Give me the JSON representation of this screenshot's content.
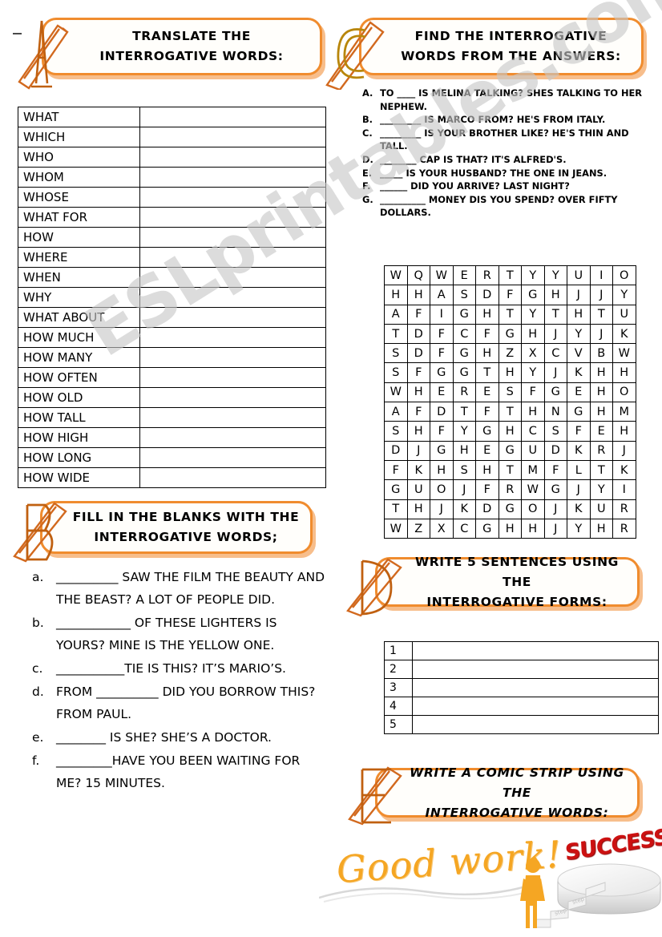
{
  "theme": {
    "accent": "#F08C2E",
    "accent_shadow": "#F7BE8C",
    "watermark_color": "#c8c8c8",
    "goodwork_color": "#F5A623",
    "success_color": "#CC1111"
  },
  "watermark": {
    "text": "ESLprintables.com"
  },
  "sections": {
    "a": {
      "marker": "A",
      "title_line1": "TRANSLATE THE",
      "title_line2": "INTERROGATIVE WORDS:",
      "words": [
        "WHAT",
        "WHICH",
        "WHO",
        "WHOM",
        "WHOSE",
        "WHAT FOR",
        "HOW",
        "WHERE",
        "WHEN",
        "WHY",
        "WHAT ABOUT",
        "HOW MUCH",
        "HOW MANY",
        "HOW OFTEN",
        "HOW OLD",
        "HOW TALL",
        "HOW HIGH",
        "HOW LONG",
        "HOW WIDE"
      ]
    },
    "b": {
      "marker": "B",
      "title_line1": "FILL IN THE BLANKS WITH THE",
      "title_line2": "INTERROGATIVE WORDS;",
      "items": [
        {
          "mark": "a.",
          "text": "__________ SAW THE FILM THE BEAUTY AND THE BEAST? A LOT OF PEOPLE DID."
        },
        {
          "mark": "b.",
          "text": "____________ OF THESE LIGHTERS IS YOURS? MINE IS THE YELLOW ONE."
        },
        {
          "mark": "c.",
          "text": "___________TIE IS THIS? IT’S MARIO’S."
        },
        {
          "mark": "d.",
          "text": "FROM __________ DID YOU BORROW THIS? FROM PAUL."
        },
        {
          "mark": "e.",
          "text": "________ IS SHE? SHE’S A DOCTOR."
        },
        {
          "mark": "f.",
          "text": "_________HAVE YOU BEEN WAITING FOR ME? 15 MINUTES."
        }
      ]
    },
    "c": {
      "marker": "C",
      "title_line1": "FIND THE INTERROGATIVE",
      "title_line2": "WORDS FROM THE ANSWERS:",
      "items": [
        {
          "mark": "A.",
          "text": "TO ____ IS MELINA TALKING? SHES TALKING TO HER NEPHEW."
        },
        {
          "mark": "B.",
          "text": "_________ IS MARCO FROM? HE'S FROM ITALY."
        },
        {
          "mark": "C.",
          "text": "_________ IS YOUR BROTHER LIKE? HE'S THIN AND TALL."
        },
        {
          "mark": "D.",
          "text": "________ CAP IS THAT? IT'S ALFRED'S."
        },
        {
          "mark": "E.",
          "text": "_____ IS YOUR HUSBAND? THE ONE IN JEANS."
        },
        {
          "mark": "F.",
          "text": "______ DID YOU ARRIVE? LAST NIGHT?"
        },
        {
          "mark": "G.",
          "text": "__________ MONEY DIS YOU SPEND? OVER FIFTY DOLLARS."
        }
      ],
      "wordsearch": {
        "rows": 14,
        "cols": 11,
        "grid": [
          [
            "W",
            "Q",
            "W",
            "E",
            "R",
            "T",
            "Y",
            "Y",
            "U",
            "I",
            "O"
          ],
          [
            "H",
            "H",
            "A",
            "S",
            "D",
            "F",
            "G",
            "H",
            "J",
            "J",
            "Y"
          ],
          [
            "A",
            "F",
            "I",
            "G",
            "H",
            "T",
            "Y",
            "T",
            "H",
            "T",
            "U"
          ],
          [
            "T",
            "D",
            "F",
            "C",
            "F",
            "G",
            "H",
            "J",
            "Y",
            "J",
            "K"
          ],
          [
            "S",
            "D",
            "F",
            "G",
            "H",
            "Z",
            "X",
            "C",
            "V",
            "B",
            "W"
          ],
          [
            "S",
            "F",
            "G",
            "G",
            "T",
            "H",
            "Y",
            "J",
            "K",
            "H",
            "H"
          ],
          [
            "W",
            "H",
            "E",
            "R",
            "E",
            "S",
            "F",
            "G",
            "E",
            "H",
            "O"
          ],
          [
            "A",
            "F",
            "D",
            "T",
            "F",
            "T",
            "H",
            "N",
            "G",
            "H",
            "M"
          ],
          [
            "S",
            "H",
            "F",
            "Y",
            "G",
            "H",
            "C",
            "S",
            "F",
            "E",
            "H"
          ],
          [
            "D",
            "J",
            "G",
            "H",
            "E",
            "G",
            "U",
            "D",
            "K",
            "R",
            "J"
          ],
          [
            "F",
            "K",
            "H",
            "S",
            "H",
            "T",
            "M",
            "F",
            "L",
            "T",
            "K"
          ],
          [
            "G",
            "U",
            "O",
            "J",
            "F",
            "R",
            "W",
            "G",
            "J",
            "Y",
            "I"
          ],
          [
            "T",
            "H",
            "J",
            "K",
            "D",
            "G",
            "O",
            "J",
            "K",
            "U",
            "R"
          ],
          [
            "W",
            "Z",
            "X",
            "C",
            "G",
            "H",
            "H",
            "J",
            "Y",
            "H",
            "R"
          ]
        ]
      }
    },
    "d": {
      "marker": "D",
      "title_line1": "WRITE 5 SENTENCES USING THE",
      "title_line2": "INTERROGATIVE FORMS:",
      "rows": [
        "1",
        "2",
        "3",
        "4",
        "5"
      ]
    },
    "e": {
      "marker": "E",
      "title_line1": "WRITE A COMIC STRIP USING THE",
      "title_line2": "INTERROGATIVE WORDS:"
    }
  },
  "footer": {
    "good_work": "Good work!",
    "success": "SUCCESS"
  }
}
